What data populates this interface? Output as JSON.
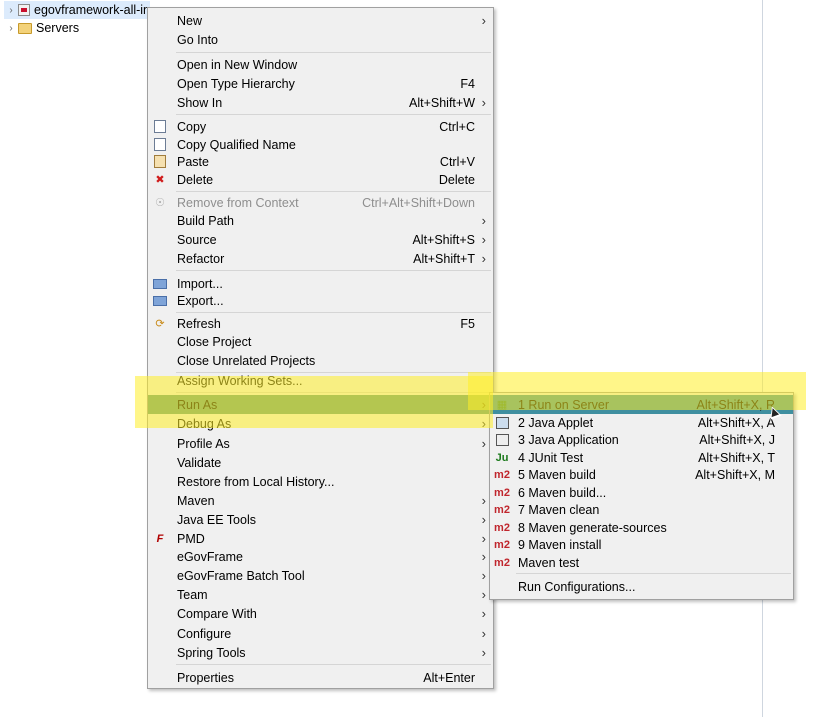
{
  "tree": [
    {
      "label": "egovframework-all-in",
      "icon": "project-icon"
    },
    {
      "label": "Servers",
      "icon": "folder-icon"
    }
  ],
  "main_menu": {
    "new": {
      "label": "New"
    },
    "go_into": {
      "label": "Go Into"
    },
    "open_new_window": {
      "label": "Open in New Window"
    },
    "open_type_hierarchy": {
      "label": "Open Type Hierarchy",
      "accel": "F4"
    },
    "show_in": {
      "label": "Show In",
      "accel": "Alt+Shift+W"
    },
    "copy": {
      "label": "Copy",
      "accel": "Ctrl+C"
    },
    "copy_qualified": {
      "label": "Copy Qualified Name"
    },
    "paste": {
      "label": "Paste",
      "accel": "Ctrl+V"
    },
    "delete": {
      "label": "Delete",
      "accel": "Delete"
    },
    "remove_context": {
      "label": "Remove from Context",
      "accel": "Ctrl+Alt+Shift+Down"
    },
    "build_path": {
      "label": "Build Path"
    },
    "source": {
      "label": "Source",
      "accel": "Alt+Shift+S"
    },
    "refactor": {
      "label": "Refactor",
      "accel": "Alt+Shift+T"
    },
    "import": {
      "label": "Import..."
    },
    "export": {
      "label": "Export..."
    },
    "refresh": {
      "label": "Refresh",
      "accel": "F5"
    },
    "close_project": {
      "label": "Close Project"
    },
    "close_unrelated": {
      "label": "Close Unrelated Projects"
    },
    "assign_working_sets": {
      "label": "Assign Working Sets..."
    },
    "run_as": {
      "label": "Run As"
    },
    "debug_as": {
      "label": "Debug As"
    },
    "profile_as": {
      "label": "Profile As"
    },
    "validate": {
      "label": "Validate"
    },
    "restore_history": {
      "label": "Restore from Local History..."
    },
    "maven": {
      "label": "Maven"
    },
    "java_ee_tools": {
      "label": "Java EE Tools"
    },
    "pmd": {
      "label": "PMD"
    },
    "egovframe": {
      "label": "eGovFrame"
    },
    "egovframe_batch": {
      "label": "eGovFrame Batch Tool"
    },
    "team": {
      "label": "Team"
    },
    "compare_with": {
      "label": "Compare With"
    },
    "configure": {
      "label": "Configure"
    },
    "spring_tools": {
      "label": "Spring Tools"
    },
    "properties": {
      "label": "Properties",
      "accel": "Alt+Enter"
    }
  },
  "run_as_menu": {
    "run_on_server": {
      "label": "1 Run on Server",
      "accel": "Alt+Shift+X, R"
    },
    "java_applet": {
      "label": "2 Java Applet",
      "accel": "Alt+Shift+X, A"
    },
    "java_application": {
      "label": "3 Java Application",
      "accel": "Alt+Shift+X, J"
    },
    "junit_test": {
      "label": "4 JUnit Test",
      "accel": "Alt+Shift+X, T"
    },
    "maven_build": {
      "label": "5 Maven build",
      "accel": "Alt+Shift+X, M"
    },
    "maven_build_dots": {
      "label": "6 Maven build..."
    },
    "maven_clean": {
      "label": "7 Maven clean"
    },
    "maven_generate_sources": {
      "label": "8 Maven generate-sources"
    },
    "maven_install": {
      "label": "9 Maven install"
    },
    "maven_test": {
      "label": "Maven test"
    },
    "run_configurations": {
      "label": "Run Configurations..."
    }
  },
  "icons": {
    "ju": "Ju",
    "m2": "m2"
  },
  "colors": {
    "menu_bg": "#f0f0f0",
    "selection_run_as": "#5a9682",
    "selection_submenu": "#3f8fa0",
    "highlighter": "#ffee28",
    "disabled_text": "#8e8e8e"
  }
}
